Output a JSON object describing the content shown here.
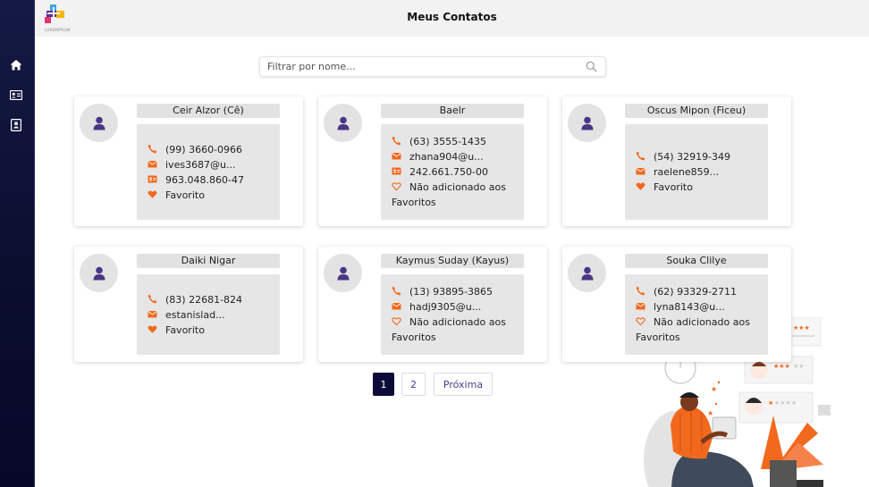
{
  "header": {
    "title": "Meus Contatos",
    "logo_text": "LOREMIPSUM"
  },
  "sidebar": {
    "items": [
      {
        "icon": "home-icon"
      },
      {
        "icon": "id-card-icon"
      },
      {
        "icon": "contacts-book-icon"
      }
    ]
  },
  "search": {
    "placeholder": "Filtrar por nome..."
  },
  "contacts": [
    {
      "name": "Ceir Alzor (Cê)",
      "phone": "(99) 3660-0966",
      "email": "ives3687@u...",
      "doc": "963.048.860-47",
      "favorite": "Favorito"
    },
    {
      "name": "Baelr",
      "phone": "(63) 3555-1435",
      "email": "zhana904@u...",
      "doc": "242.661.750-00",
      "favorite": "Não adicionado aos Favoritos"
    },
    {
      "name": "Oscus Mipon (Ficeu)",
      "phone": "(54) 32919-349",
      "email": "raelene859...",
      "favorite": "Favorito"
    },
    {
      "name": "Daiki Nigar",
      "phone": "(83) 22681-824",
      "email": "estanislad...",
      "favorite": "Favorito"
    },
    {
      "name": "Kaymus Suday (Kayus)",
      "phone": "(13) 93895-3865",
      "email": "hadj9305@u...",
      "favorite": "Não adicionado aos Favoritos"
    },
    {
      "name": "Souka Clilye",
      "phone": "(62) 93329-2711",
      "email": "lyna8143@u...",
      "favorite": "Não adicionado aos Favoritos"
    }
  ],
  "pagination": {
    "pages": [
      "1",
      "2"
    ],
    "current": "1",
    "next": "Próxima"
  },
  "colors": {
    "accent": "#f2691e",
    "avatar_icon": "#4b3585",
    "sidebar": "#0b0d2e",
    "active_page": "#0c0b38"
  }
}
